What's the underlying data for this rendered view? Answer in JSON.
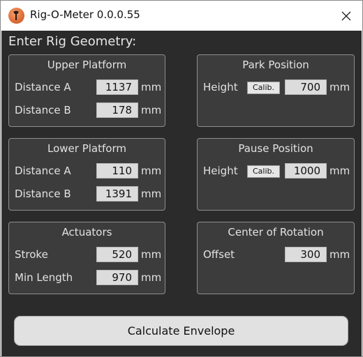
{
  "window": {
    "title": "Rig-O-Meter 0.0.0.55",
    "app_icon": "wrench-gauge-icon",
    "close_icon": "close-icon"
  },
  "heading": "Enter Rig Geometry:",
  "upper_platform": {
    "title": "Upper Platform",
    "rows": [
      {
        "label": "Distance A",
        "value": "1137",
        "unit": "mm"
      },
      {
        "label": "Distance B",
        "value": "178",
        "unit": "mm"
      }
    ]
  },
  "lower_platform": {
    "title": "Lower Platform",
    "rows": [
      {
        "label": "Distance A",
        "value": "110",
        "unit": "mm"
      },
      {
        "label": "Distance B",
        "value": "1391",
        "unit": "mm"
      }
    ]
  },
  "actuators": {
    "title": "Actuators",
    "rows": [
      {
        "label": "Stroke",
        "value": "520",
        "unit": "mm"
      },
      {
        "label": "Min Length",
        "value": "970",
        "unit": "mm"
      }
    ]
  },
  "park_position": {
    "title": "Park Position",
    "label": "Height",
    "calib_label": "Calib.",
    "value": "700",
    "unit": "mm"
  },
  "pause_position": {
    "title": "Pause Position",
    "label": "Height",
    "calib_label": "Calib.",
    "value": "1000",
    "unit": "mm"
  },
  "center_of_rotation": {
    "title": "Center of Rotation",
    "label": "Offset",
    "value": "300",
    "unit": "mm"
  },
  "calculate_button": "Calculate Envelope"
}
